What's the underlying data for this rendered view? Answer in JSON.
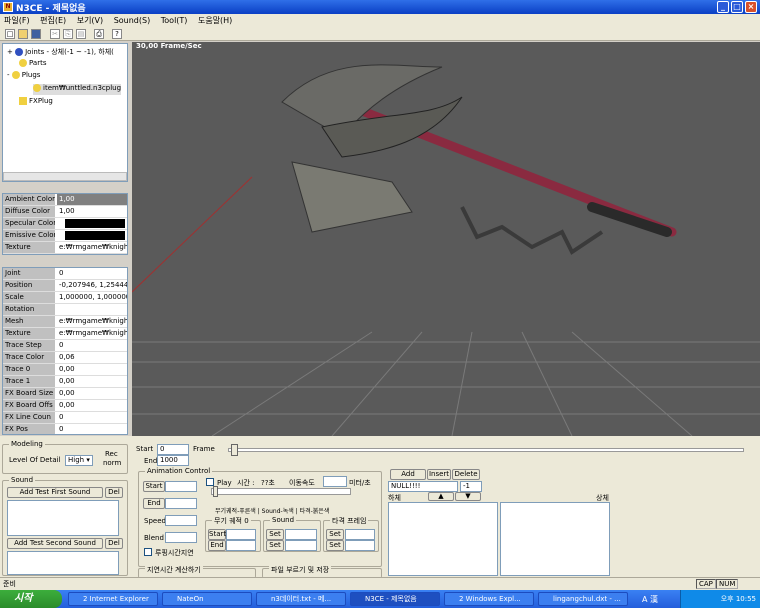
{
  "window": {
    "title": "N3CE - 제목없음",
    "minimize": "_",
    "maximize": "□",
    "close": "×"
  },
  "menu": [
    "파일(F)",
    "편집(E)",
    "보기(V)",
    "Sound(S)",
    "Tool(T)",
    "도움말(H)"
  ],
  "toolbar_icons": [
    "new-file-icon",
    "open-folder-icon",
    "save-icon",
    "cut-icon",
    "copy-icon",
    "paste-icon",
    "print-icon",
    "help-icon"
  ],
  "tree": [
    {
      "label": "Joints - 상체(-1 ~ -1), 하체(",
      "expander": "+"
    },
    {
      "label": "Parts",
      "expander": "+"
    },
    {
      "label": "Plugs",
      "expander": "-"
    },
    {
      "label": "item₩unttled.n3cplug",
      "expander": ""
    },
    {
      "label": "FXPlug",
      "expander": ""
    }
  ],
  "material": [
    {
      "key": "Ambient Color",
      "value": "1,00"
    },
    {
      "key": "Diffuse Color",
      "value": "1,00"
    },
    {
      "key": "Specular Color",
      "value": "",
      "swatch": "#000000"
    },
    {
      "key": "Emissive Color",
      "value": "",
      "swatch": "#000000"
    },
    {
      "key": "Texture",
      "value": "e:₩rmgame₩knight"
    }
  ],
  "joint_props": [
    {
      "key": "Joint",
      "value": "0"
    },
    {
      "key": "Position",
      "value": "-0,207946, 1,254449, 2"
    },
    {
      "key": "Scale",
      "value": "1,000000, 1,000000, 1,"
    },
    {
      "key": "Rotation",
      "value": ""
    },
    {
      "key": "Mesh",
      "value": "e:₩rmgame₩knighto"
    },
    {
      "key": "Texture",
      "value": "e:₩rmgame₩knighto"
    },
    {
      "key": "Trace Step",
      "value": "0"
    },
    {
      "key": "Trace Color",
      "value": "0,06"
    },
    {
      "key": "Trace 0",
      "value": "0,00"
    },
    {
      "key": "Trace 1",
      "value": "0,00"
    },
    {
      "key": "FX Board Size",
      "value": "0,00"
    },
    {
      "key": "FX Board Offs",
      "value": "0,00"
    },
    {
      "key": "FX Line Coun",
      "value": "0"
    },
    {
      "key": "FX Pos",
      "value": "0"
    }
  ],
  "viewport": {
    "fps": "30,00 Frame/Sec"
  },
  "modeling": {
    "title": "Modeling",
    "lod_label": "Level Of Detail",
    "lod_value": "High",
    "rec_label": "Rec",
    "normal_label": "norm"
  },
  "sound": {
    "title": "Sound",
    "add_first": "Add Test First Sound",
    "add_second": "Add Test Second Sound",
    "del": "Del"
  },
  "frame": {
    "start_label": "Start",
    "start_value": "0",
    "end_label": "End",
    "end_value": "1000",
    "frame_label": "Frame"
  },
  "anim": {
    "title": "Animation Control",
    "start": "Start",
    "end": "End",
    "speed": "Speed",
    "blend": "Blend",
    "play": "Play",
    "time_label": "시간 :",
    "time_value": "??초",
    "move_label": "이동속도",
    "move_unit": "미터/초",
    "legend": "무기궤적-푸른색 | Sound-녹색 | 타격-붉은색",
    "weapon_title": "무기 궤적 0",
    "weapon_start": "Start",
    "weapon_end": "End",
    "sound_title": "Sound",
    "set": "Set",
    "hit_title": "타격 프레임",
    "loop_label": "루핑시간지연",
    "delay_label": "지연시간 계산하기",
    "file_label": "파일 부르기 및 저장"
  },
  "events": {
    "add": "Add",
    "insert": "Insert",
    "delete": "Delete",
    "name_value": "NULL!!!!",
    "index_value": "-1",
    "lower": "하체",
    "upper": "상체",
    "up": "▲",
    "down": "▼"
  },
  "status": {
    "text": "준비",
    "cap": "CAP",
    "num": "NUM"
  },
  "taskbar": {
    "start": "시작",
    "tasks": [
      "2 Internet Explorer",
      "NateOn",
      "n3데이터.txt - 메...",
      "N3CE - 제목없음",
      "2 Windows Expl...",
      "lingangchul.dxt - ..."
    ],
    "lang": "A 漢",
    "clock": "오후 10:55"
  }
}
